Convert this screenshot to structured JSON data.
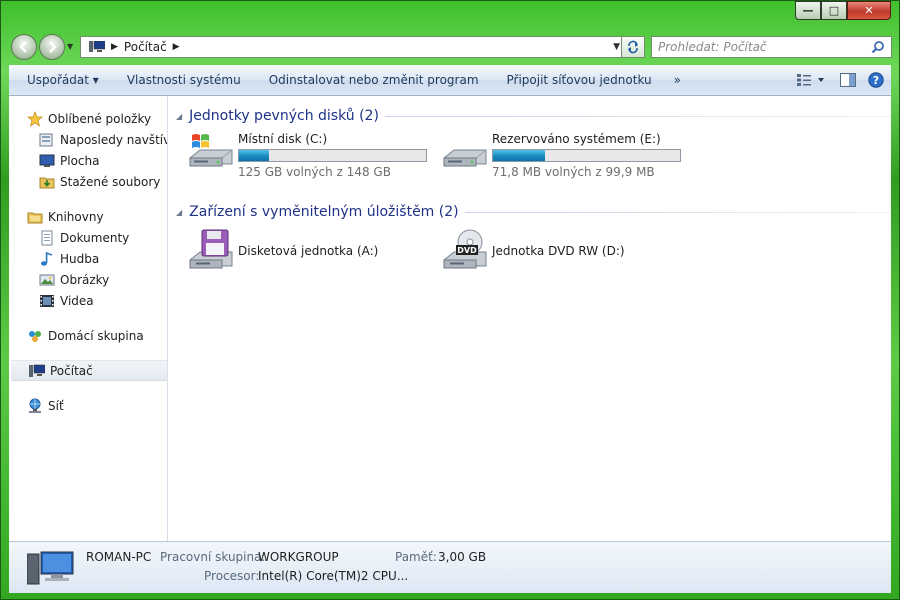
{
  "window": {
    "caption_buttons": {
      "minimize": "—",
      "maximize": "□",
      "close": "✕"
    }
  },
  "nav": {
    "address_crumb": "Počítač",
    "search_placeholder": "Prohledat: Počítač"
  },
  "toolbar": {
    "items": [
      "Uspořádat",
      "Vlastnosti systému",
      "Odinstalovat nebo změnit program",
      "Připojit síťovou jednotku"
    ],
    "organize_arrow": "▾",
    "more": "»"
  },
  "sidebar": {
    "favorites": {
      "label": "Oblíbené položky",
      "items": [
        "Naposledy navštívené",
        "Plocha",
        "Stažené soubory"
      ]
    },
    "libraries": {
      "label": "Knihovny",
      "items": [
        "Dokumenty",
        "Hudba",
        "Obrázky",
        "Videa"
      ]
    },
    "homegroup": "Domácí skupina",
    "computer": "Počítač",
    "network": "Síť"
  },
  "content": {
    "hard_disks_header": "Jednotky pevných disků (2)",
    "hard_disks": [
      {
        "name": "Místní disk (C:)",
        "free": "125 GB volných z 148 GB",
        "used_fraction": 0.16
      },
      {
        "name": "Rezervováno systémem (E:)",
        "free": "71,8 MB volných z 99,9 MB",
        "used_fraction": 0.28
      }
    ],
    "removable_header": "Zařízení s vyměnitelným úložištěm (2)",
    "removable": [
      {
        "name": "Disketová jednotka (A:)"
      },
      {
        "name": "Jednotka DVD RW (D:)",
        "badge": "DVD"
      }
    ]
  },
  "details": {
    "computer_name": "ROMAN-PC",
    "workgroup_label": "Pracovní skupina:",
    "workgroup_value": "WORKGROUP",
    "memory_label": "Paměť:",
    "memory_value": "3,00 GB",
    "processor_label": "Procesor:",
    "processor_value": "Intel(R) Core(TM)2 CPU..."
  },
  "colors": {
    "accent": "#1e3287",
    "drive_bar": "#1a8bc2",
    "frame_green": "#3fbf2c"
  }
}
